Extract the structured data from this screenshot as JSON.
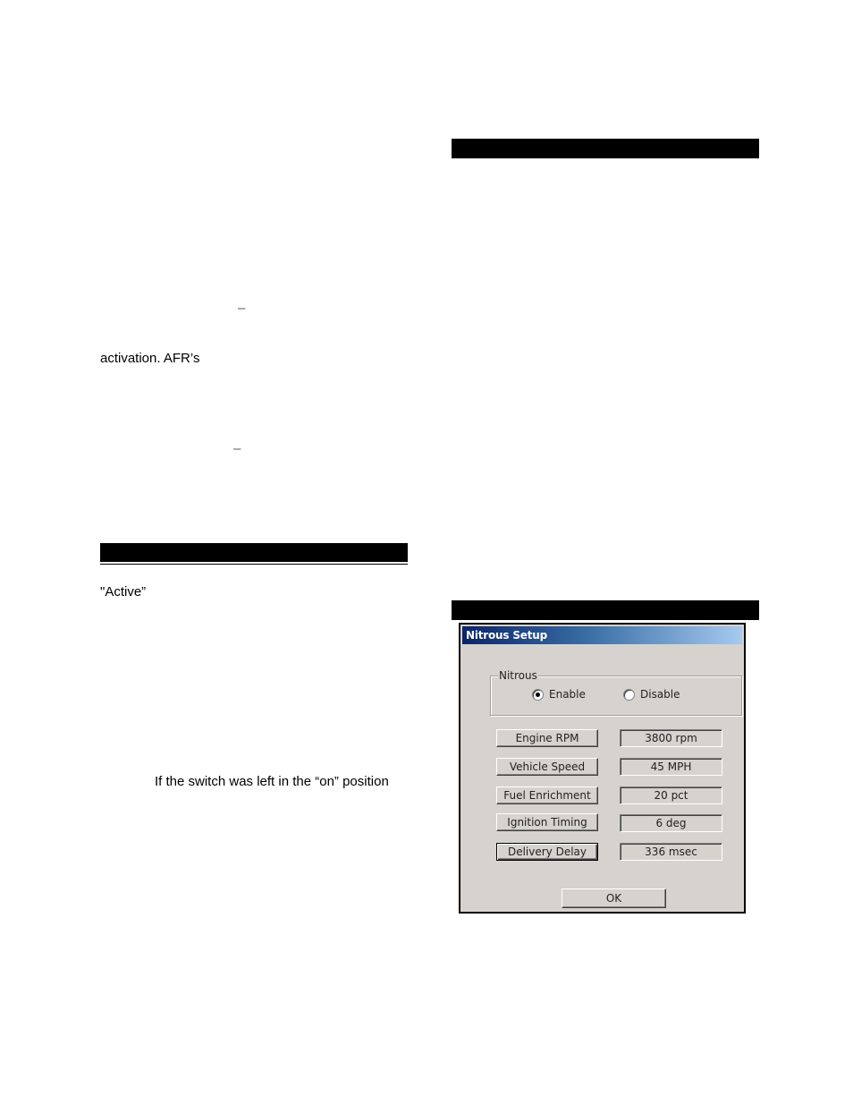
{
  "document": {
    "left_column": {
      "dash_1": "–",
      "line_afr": "activation. AFR’s",
      "dash_2": "–",
      "quote_active": "\"Active”",
      "line_switch": "If the switch was left in the “on” position"
    }
  },
  "dialog": {
    "title": "Nitrous Setup",
    "group": {
      "label": "Nitrous",
      "options": [
        {
          "label": "Enable",
          "checked": true
        },
        {
          "label": "Disable",
          "checked": false
        }
      ]
    },
    "rows": [
      {
        "button": "Engine RPM",
        "value": "3800 rpm"
      },
      {
        "button": "Vehicle Speed",
        "value": "45 MPH"
      },
      {
        "button": "Fuel Enrichment",
        "value": "20 pct"
      },
      {
        "button": "Ignition Timing",
        "value": "6 deg"
      },
      {
        "button": "Delivery Delay",
        "value": "336 msec"
      }
    ],
    "ok_label": "OK"
  },
  "colors": {
    "section_bar": "#000000",
    "dialog_face": "#d6d3ce",
    "titlebar_start": "#0a246a",
    "titlebar_end": "#a6caf0"
  }
}
